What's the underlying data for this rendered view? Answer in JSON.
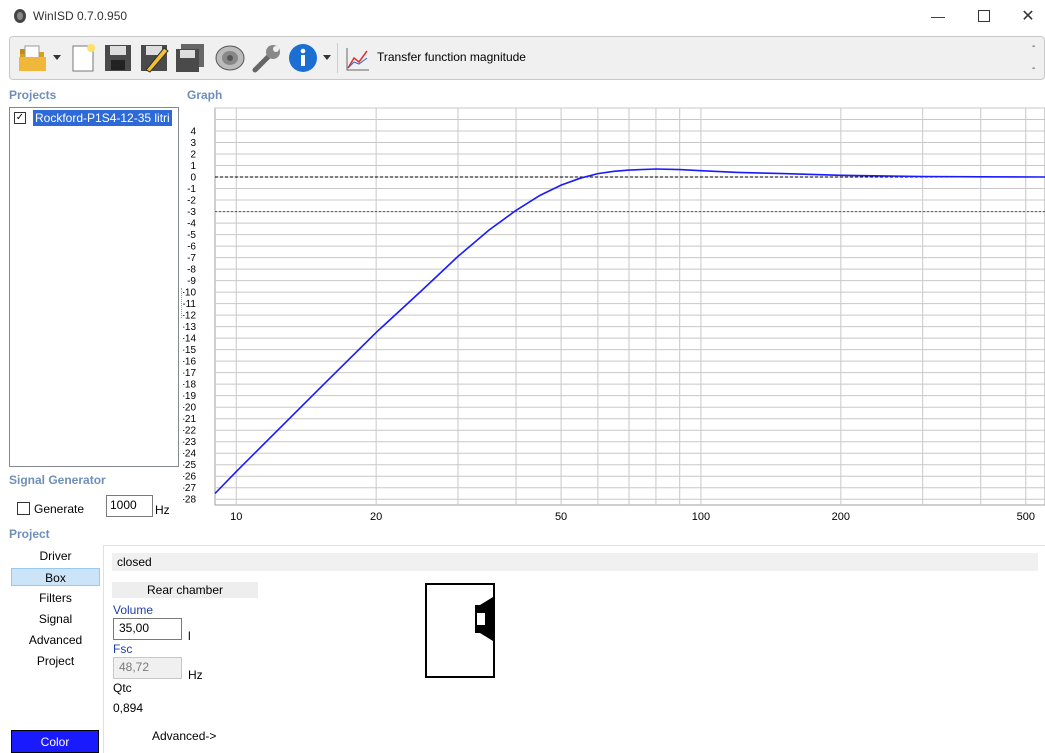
{
  "window": {
    "title": "WinISD 0.7.0.950"
  },
  "toolbar": {
    "label": "Transfer function magnitude",
    "dash_top": "-",
    "dash_bottom": "-",
    "icons": [
      "open-folder-icon",
      "dropdown-arrow-icon",
      "new-document-icon",
      "save-icon",
      "edit-save-icon",
      "save-all-icon",
      "speaker-icon",
      "wrench-icon",
      "info-icon",
      "dropdown-arrow-icon",
      "graph-icon"
    ]
  },
  "projects": {
    "heading": "Projects",
    "items": [
      {
        "label": "Rockford-P1S4-12-35 litri",
        "checked": true
      }
    ]
  },
  "graph": {
    "heading": "Graph"
  },
  "signal_generator": {
    "heading": "Signal Generator",
    "generate_label": "Generate",
    "frequency_value": "1000",
    "frequency_unit": "Hz"
  },
  "project_nav": {
    "heading": "Project",
    "items": [
      "Driver",
      "Box",
      "Filters",
      "Signal",
      "Advanced",
      "Project"
    ],
    "selected": "Box",
    "color_label": "Color",
    "color_value": "#1a1aff"
  },
  "box": {
    "type": "closed",
    "chamber_label": "Rear chamber",
    "volume_label": "Volume",
    "volume_value": "35,00",
    "volume_unit": "l",
    "fsc_label": "Fsc",
    "fsc_value": "48,72",
    "fsc_unit": "Hz",
    "qtc_label": "Qtc",
    "qtc_value": "0,894",
    "advanced_label": "Advanced->"
  },
  "chart_data": {
    "type": "line",
    "xscale": "log",
    "xlim": [
      9,
      550
    ],
    "ylim": [
      -28.5,
      6
    ],
    "x_ticks": [
      10,
      20,
      50,
      100,
      200,
      500
    ],
    "y_ticks": [
      4,
      3,
      2,
      1,
      0,
      -1,
      -2,
      -3,
      -4,
      -5,
      -6,
      -7,
      -8,
      -9,
      -10,
      -11,
      -12,
      -13,
      -14,
      -15,
      -16,
      -17,
      -18,
      -19,
      -20,
      -21,
      -22,
      -23,
      -24,
      -25,
      -26,
      -27,
      -28
    ],
    "reference_lines": [
      0,
      -3
    ],
    "grid": true,
    "series": [
      {
        "color": "#1a1aff",
        "x": [
          9,
          10,
          12,
          15,
          20,
          25,
          30,
          35,
          40,
          45,
          50,
          55,
          60,
          65,
          70,
          80,
          90,
          100,
          120,
          150,
          200,
          300,
          400,
          550
        ],
        "y": [
          -27.5,
          -25.6,
          -22.4,
          -18.5,
          -13.5,
          -9.9,
          -6.9,
          -4.6,
          -2.9,
          -1.6,
          -0.7,
          -0.1,
          0.3,
          0.5,
          0.6,
          0.7,
          0.65,
          0.55,
          0.4,
          0.3,
          0.15,
          0.05,
          0.02,
          0.0
        ]
      }
    ]
  }
}
